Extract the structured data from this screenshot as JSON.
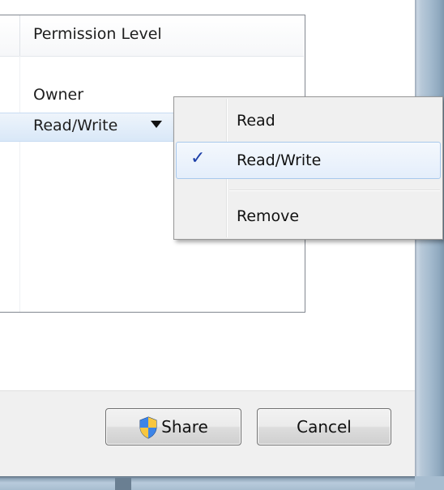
{
  "permissions_list": {
    "header": {
      "permission_level": "Permission Level"
    },
    "rows": [
      {
        "permission": "Owner"
      },
      {
        "permission": "Read/Write",
        "selected": true
      }
    ]
  },
  "permission_menu": {
    "items": [
      {
        "label": "Read",
        "checked": false
      },
      {
        "label": "Read/Write",
        "checked": true
      },
      {
        "label": "Remove",
        "checked": false
      }
    ],
    "check_glyph": "✓"
  },
  "buttons": {
    "share": "Share",
    "cancel": "Cancel",
    "share_icon": "uac-shield-icon"
  },
  "colors": {
    "selection": "#d9e8f8",
    "menu_background": "#f0f0f0",
    "check": "#1c3fa8"
  }
}
